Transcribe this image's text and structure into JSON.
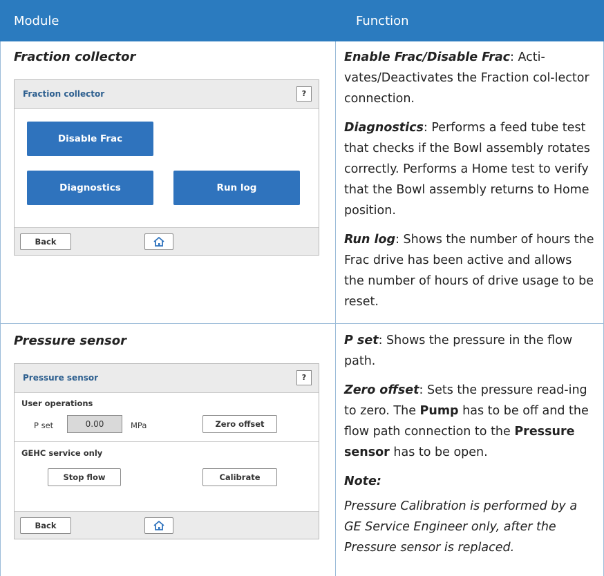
{
  "header": {
    "col_module": "Module",
    "col_function": "Function"
  },
  "rows": [
    {
      "module_title": "Fraction collector",
      "screen": {
        "title": "Fraction collector",
        "help": "?",
        "disable_frac": "Disable Frac",
        "diagnostics": "Diagnostics",
        "run_log": "Run log",
        "back": "Back"
      },
      "desc": [
        {
          "term": "Enable Frac/Disable Frac",
          "text": ": Acti-vates/Deactivates the Fraction col-lector connection."
        },
        {
          "term": "Diagnostics",
          "text": ": Performs a feed tube test that checks if the Bowl assembly rotates correctly. Performs a Home test to verify that the Bowl assembly returns to Home position."
        },
        {
          "term": "Run log",
          "text": ": Shows the number of hours the Frac drive has been active and allows the number of hours of drive usage to be reset."
        }
      ]
    },
    {
      "module_title": "Pressure sensor",
      "screen": {
        "title": "Pressure sensor",
        "help": "?",
        "user_ops": "User operations",
        "p_set": "P set",
        "p_value": "0.00",
        "unit": "MPa",
        "zero_offset": "Zero offset",
        "gehc": "GEHC service only",
        "stop_flow": "Stop flow",
        "calibrate": "Calibrate",
        "back": "Back"
      },
      "desc": {
        "p_set_term": "P set",
        "p_set_text": ": Shows the pressure in the flow path.",
        "zero_term": "Zero offset",
        "zero_text_1": ": Sets the pressure read-ing to zero. The ",
        "pump": "Pump",
        "zero_text_2": " has to be off and the flow path connection to the ",
        "sensor": "Pressure sensor",
        "zero_text_3": " has to be open.",
        "note_heading": "Note:",
        "note_text": "Pressure Calibration is performed by a GE Service Engineer only, after the Pressure sensor is replaced."
      }
    }
  ]
}
